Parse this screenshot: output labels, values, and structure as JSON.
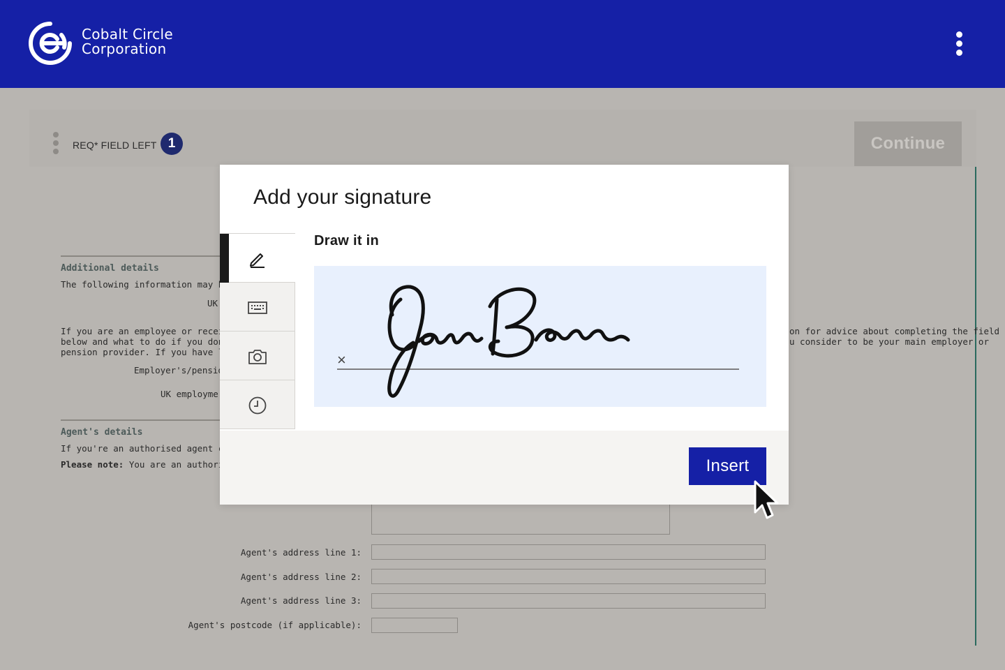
{
  "header": {
    "brand_line1": "Cobalt Circle",
    "brand_line2": "Corporation",
    "logo_icon": "cobalt-circle-logo",
    "menu_icon": "kebab-menu-icon",
    "color": "#1520a6"
  },
  "toolbar": {
    "req_label": "REQ* FIELD LEFT",
    "req_count": "1",
    "continue_label": "Continue"
  },
  "document": {
    "additional_title": "Additional details",
    "additional_line1": "The following information may help",
    "uk_label": "UK",
    "employee_line1_left": "If you are an employee or receive a",
    "employee_line1_right": "on for advice about completing the field",
    "employee_line2_left": "below and what to do if you don't h",
    "employee_line2_right": "u consider to be your main employer or",
    "employee_line3_left": "pension provider. If you have left e",
    "employer_label": "Employer's/pension",
    "uk_employment_label": "UK employme",
    "agent_title": "Agent's details",
    "agent_line1": "If you're an authorised agent comp",
    "note_bold": "Please note:",
    "note_text": "You are an authorise",
    "agent_address_1": "Agent's address line 1:",
    "agent_address_2": "Agent's address line 2:",
    "agent_address_3": "Agent's address line 3:",
    "agent_postcode": "Agent's postcode (if applicable):"
  },
  "modal": {
    "title": "Add your signature",
    "draw_label": "Draw it in",
    "clear_mark": "×",
    "insert_label": "Insert",
    "pad_color": "#e8f0fd",
    "tabs": [
      {
        "name": "draw",
        "icon": "pen-icon",
        "active": true
      },
      {
        "name": "type",
        "icon": "keyboard-icon",
        "active": false
      },
      {
        "name": "photo",
        "icon": "camera-icon",
        "active": false
      },
      {
        "name": "recent",
        "icon": "clock-icon",
        "active": false
      }
    ]
  }
}
